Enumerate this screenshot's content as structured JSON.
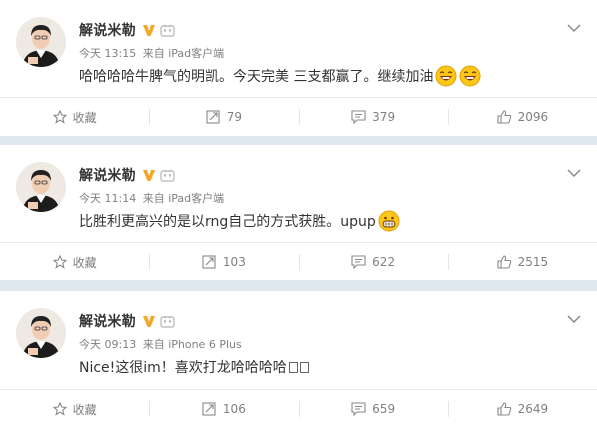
{
  "posts": [
    {
      "username": "解说米勒",
      "time": "今天 13:15",
      "source": "来自 iPad客户端",
      "text": "哈哈哈哈牛脾气的明凯。今天完美 三支都赢了。继续加油",
      "emoji": [
        "laugh-emoji",
        "laugh-emoji"
      ],
      "actions": {
        "favorite": "收藏",
        "repost": "79",
        "comment": "379",
        "like": "2096"
      }
    },
    {
      "username": "解说米勒",
      "time": "今天 11:14",
      "source": "来自 iPad客户端",
      "text": "比胜利更高兴的是以rng自己的方式获胜。upup",
      "emoji": [
        "grin-emoji"
      ],
      "actions": {
        "favorite": "收藏",
        "repost": "103",
        "comment": "622",
        "like": "2515"
      }
    },
    {
      "username": "解说米勒",
      "time": "今天 09:13",
      "source": "来自 iPhone 6 Plus",
      "text": "Nice!这很im！喜欢打龙哈哈哈哈",
      "emoji": [],
      "actions": {
        "favorite": "收藏",
        "repost": "106",
        "comment": "659",
        "like": "2649"
      }
    }
  ],
  "colors": {
    "verified": "#f5a623",
    "text": "#333333",
    "meta": "#808080",
    "background": "#dfe8f0"
  },
  "icons": [
    "star-icon",
    "repost-icon",
    "comment-icon",
    "like-icon",
    "chevron-down-icon",
    "verified-v-icon",
    "member-icon"
  ]
}
